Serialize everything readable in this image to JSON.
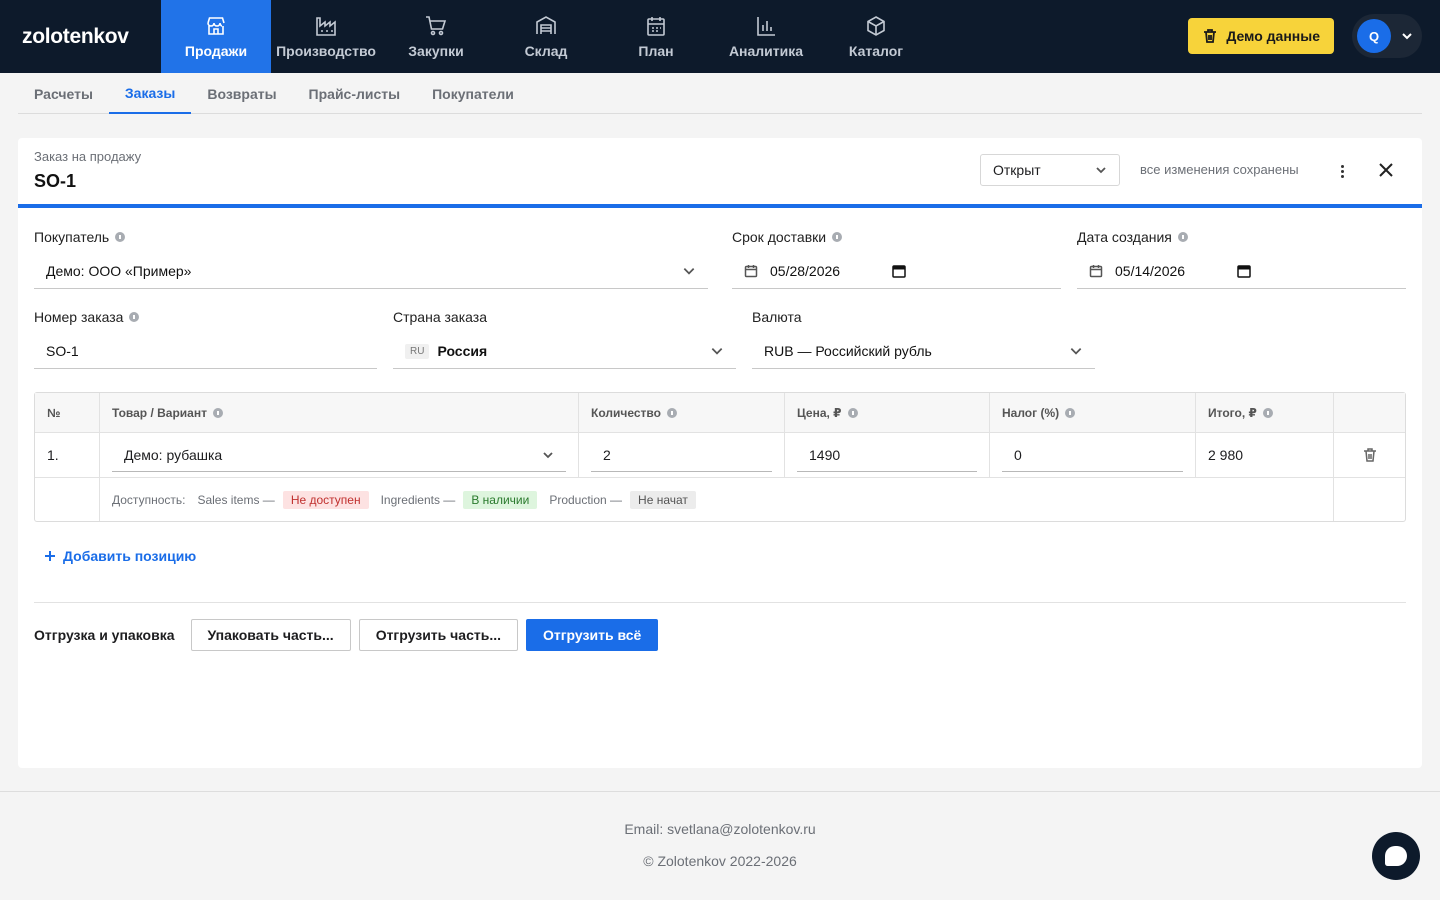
{
  "brand": "zolotenkov",
  "nav": [
    {
      "label": "Продажи",
      "icon": "store-icon",
      "active": true
    },
    {
      "label": "Производство",
      "icon": "factory-icon",
      "active": false
    },
    {
      "label": "Закупки",
      "icon": "cart-icon",
      "active": false
    },
    {
      "label": "Склад",
      "icon": "warehouse-icon",
      "active": false
    },
    {
      "label": "План",
      "icon": "calendar-icon",
      "active": false
    },
    {
      "label": "Аналитика",
      "icon": "chart-icon",
      "active": false
    },
    {
      "label": "Каталог",
      "icon": "box-icon",
      "active": false
    }
  ],
  "demo_button": "Демо данные",
  "user_initial": "Q",
  "subtabs": [
    {
      "label": "Расчеты"
    },
    {
      "label": "Заказы",
      "active": true
    },
    {
      "label": "Возвраты"
    },
    {
      "label": "Прайс-листы"
    },
    {
      "label": "Покупатели"
    }
  ],
  "order": {
    "kind": "Заказ на продажу",
    "number": "SO-1",
    "status": "Открыт",
    "saved_text": "все изменения сохранены"
  },
  "fields": {
    "customer": {
      "label": "Покупатель",
      "value": "Демо: ООО «Пример»"
    },
    "delivery": {
      "label": "Срок доставки",
      "value": "05/28/2026"
    },
    "created": {
      "label": "Дата создания",
      "value": "05/14/2026"
    },
    "order_no": {
      "label": "Номер заказа",
      "value": "SO-1"
    },
    "country": {
      "label": "Страна заказа",
      "code": "RU",
      "value": "Россия"
    },
    "currency": {
      "label": "Валюта",
      "value": "RUB — Российский рубль"
    }
  },
  "table": {
    "headers": {
      "num": "№",
      "product": "Товар / Вариант",
      "qty": "Количество",
      "price": "Цена, ₽",
      "tax": "Налог (%)",
      "total": "Итого, ₽"
    },
    "rows": [
      {
        "num": "1.",
        "product": "Демо: рубашка",
        "qty": "2",
        "price": "1490",
        "tax": "0",
        "total": "2 980"
      }
    ],
    "availability": {
      "label": "Доступность:",
      "items": [
        {
          "name": "Sales items —",
          "status": "Не доступен",
          "color": "red"
        },
        {
          "name": "Ingredients —",
          "status": "В наличии",
          "color": "green"
        },
        {
          "name": "Production —",
          "status": "Не начат",
          "color": "grey"
        }
      ]
    }
  },
  "add_line": "Добавить позицию",
  "shipping": {
    "label": "Отгрузка и упаковка",
    "pack_partial": "Упаковать часть...",
    "ship_partial": "Отгрузить часть...",
    "ship_all": "Отгрузить всё"
  },
  "footer": {
    "email": "Email: svetlana@zolotenkov.ru",
    "copyright": "© Zolotenkov 2022-2026"
  },
  "colors": {
    "nav_bg": "#0d1a2b",
    "accent": "#1a6de8",
    "demo_yellow": "#f7d33a"
  }
}
